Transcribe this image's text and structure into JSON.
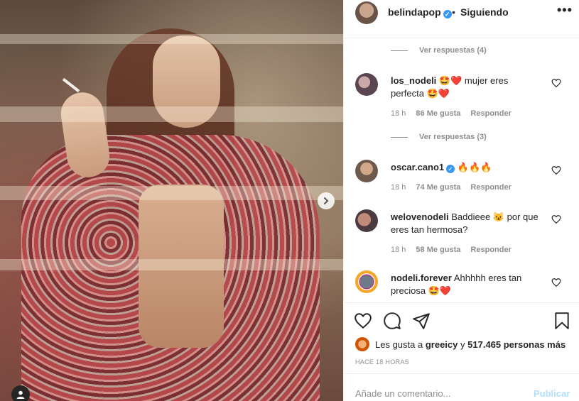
{
  "post": {
    "username": "belindapop",
    "separator": "•",
    "follow_status": "Siguiendo",
    "more": "•••"
  },
  "comments": [
    {
      "type": "replies",
      "label": "Ver respuestas (4)"
    },
    {
      "type": "comment",
      "username": "los_nodeli",
      "text": "🤩❤️ mujer eres perfecta 🤩❤️",
      "time": "18 h",
      "likes": "86 Me gusta",
      "reply": "Responder"
    },
    {
      "type": "replies",
      "label": "Ver respuestas (3)"
    },
    {
      "type": "comment",
      "username": "oscar.cano1",
      "verified": true,
      "text": "🔥🔥🔥",
      "time": "18 h",
      "likes": "74 Me gusta",
      "reply": "Responder"
    },
    {
      "type": "comment",
      "username": "welovenodeli",
      "text": "Baddieee 😼 por que eres tan hermosa?",
      "time": "18 h",
      "likes": "58 Me gusta",
      "reply": "Responder"
    },
    {
      "type": "comment",
      "username": "nodeli.forever",
      "text": "Ahhhhh eres tan preciosa 🤩❤️"
    }
  ],
  "likes": {
    "prefix": "Les gusta a ",
    "user": "greeicy",
    "middle": " y ",
    "count": "517.465 personas más"
  },
  "timestamp": "HACE 18 HORAS",
  "comment_box": {
    "placeholder": "Añade un comentario...",
    "publish": "Publicar"
  },
  "colors": {
    "verified": "#3897f0",
    "publish_disabled": "#b2dffc",
    "secondary_text": "#8e8e8e"
  },
  "icons": [
    "more-options-icon",
    "heart-icon",
    "comment-icon",
    "share-icon",
    "bookmark-icon",
    "next-arrow-icon",
    "user-tag-icon",
    "verified-icon"
  ]
}
